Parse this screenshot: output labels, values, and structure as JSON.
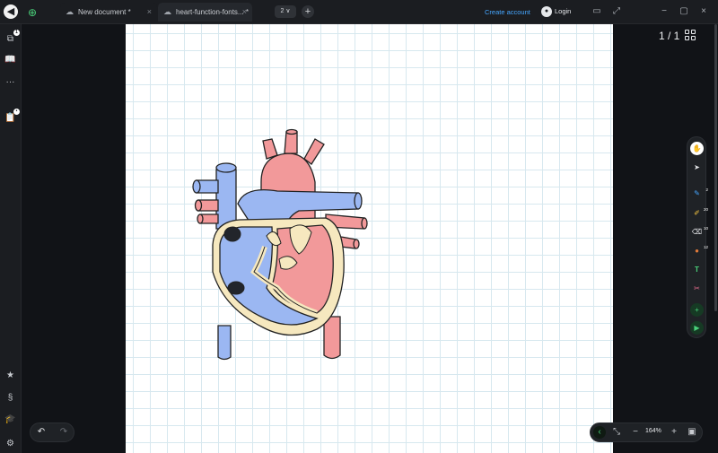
{
  "tabs": [
    {
      "title": "New document *",
      "close": "×"
    },
    {
      "title": "heart-function-fonts... *",
      "close": "×"
    }
  ],
  "header": {
    "page_count_label": "2 ∨",
    "add_tab": "+",
    "create_account": "Create account",
    "login": "Login"
  },
  "left_rail": {
    "pages_badge": "1",
    "more": "···"
  },
  "page_indicator": "1 / 1",
  "toolbar": [
    {
      "name": "hand-tool",
      "glyph": "✋",
      "badge": ""
    },
    {
      "name": "select-tool",
      "glyph": "➤",
      "badge": ""
    },
    {
      "name": "pen-tool",
      "glyph": "✎",
      "badge": "2"
    },
    {
      "name": "highlighter-tool",
      "glyph": "✐",
      "badge": "20"
    },
    {
      "name": "eraser-tool",
      "glyph": "⌫",
      "badge": "10"
    },
    {
      "name": "laser-tool",
      "glyph": "●",
      "badge": "12"
    },
    {
      "name": "text-tool",
      "glyph": "T",
      "badge": ""
    },
    {
      "name": "shape-tool",
      "glyph": "✂",
      "badge": ""
    },
    {
      "name": "add-tool",
      "glyph": "+",
      "badge": ""
    },
    {
      "name": "play-tool",
      "glyph": "▶",
      "badge": ""
    }
  ],
  "undo": {
    "undo": "↶",
    "redo": "↷"
  },
  "zoom": {
    "back": "‹",
    "fit": "⤡",
    "minus": "−",
    "level": "164%",
    "plus": "+",
    "panel": "▣"
  },
  "colors": {
    "canvas": "#ffffff",
    "grid": "#d7e8ef",
    "accent_blue": "#45a6ff",
    "accent_green": "#4ad07a",
    "heart_red": "#f2999a",
    "heart_blue": "#9bb7f2",
    "heart_wall": "#f6e8bf"
  }
}
